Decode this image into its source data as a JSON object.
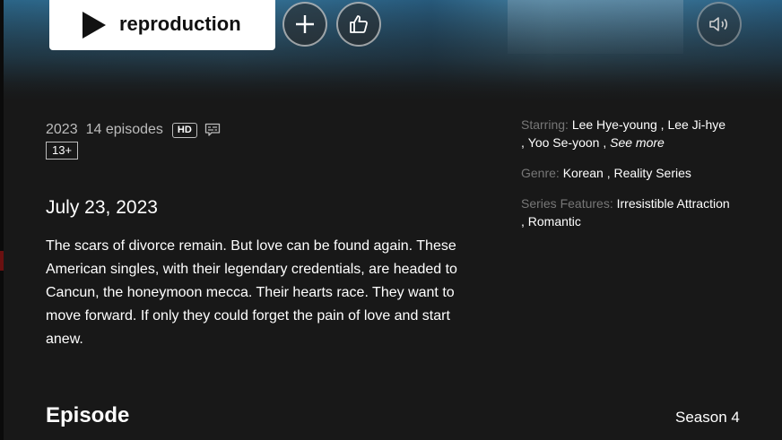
{
  "hero": {
    "play_label": "reproduction"
  },
  "details": {
    "year": "2023",
    "episodes": "14 episodes",
    "hd_badge": "HD",
    "rating": "13+",
    "release_date": "July 23, 2023",
    "synopsis": "The scars of divorce remain. But love can be found again. These American singles, with their legendary credentials, are headed to Cancun, the honeymoon mecca. Their hearts race. They want to move forward. If only they could forget the pain of love and start anew."
  },
  "info": {
    "starring_label": "Starring:",
    "cast": [
      "Lee Hye-young",
      "Lee Ji-hye",
      "Yoo Se-yoon"
    ],
    "see_more": "See more",
    "genre_label": "Genre:",
    "genres": [
      "Korean",
      "Reality Series"
    ],
    "features_label": "Series Features:",
    "features": [
      "Irresistible Attraction",
      "Romantic"
    ]
  },
  "episodes_section": {
    "heading": "Episode",
    "season": "Season 4"
  },
  "icons": {
    "play": "play-icon",
    "add": "plus-icon",
    "like": "thumbs-up-icon",
    "mute": "speaker-icon",
    "subtitles": "subtitles-icon"
  },
  "colors": {
    "background": "#181818",
    "muted_text": "#777777",
    "meta_text": "#bcbcbc"
  }
}
